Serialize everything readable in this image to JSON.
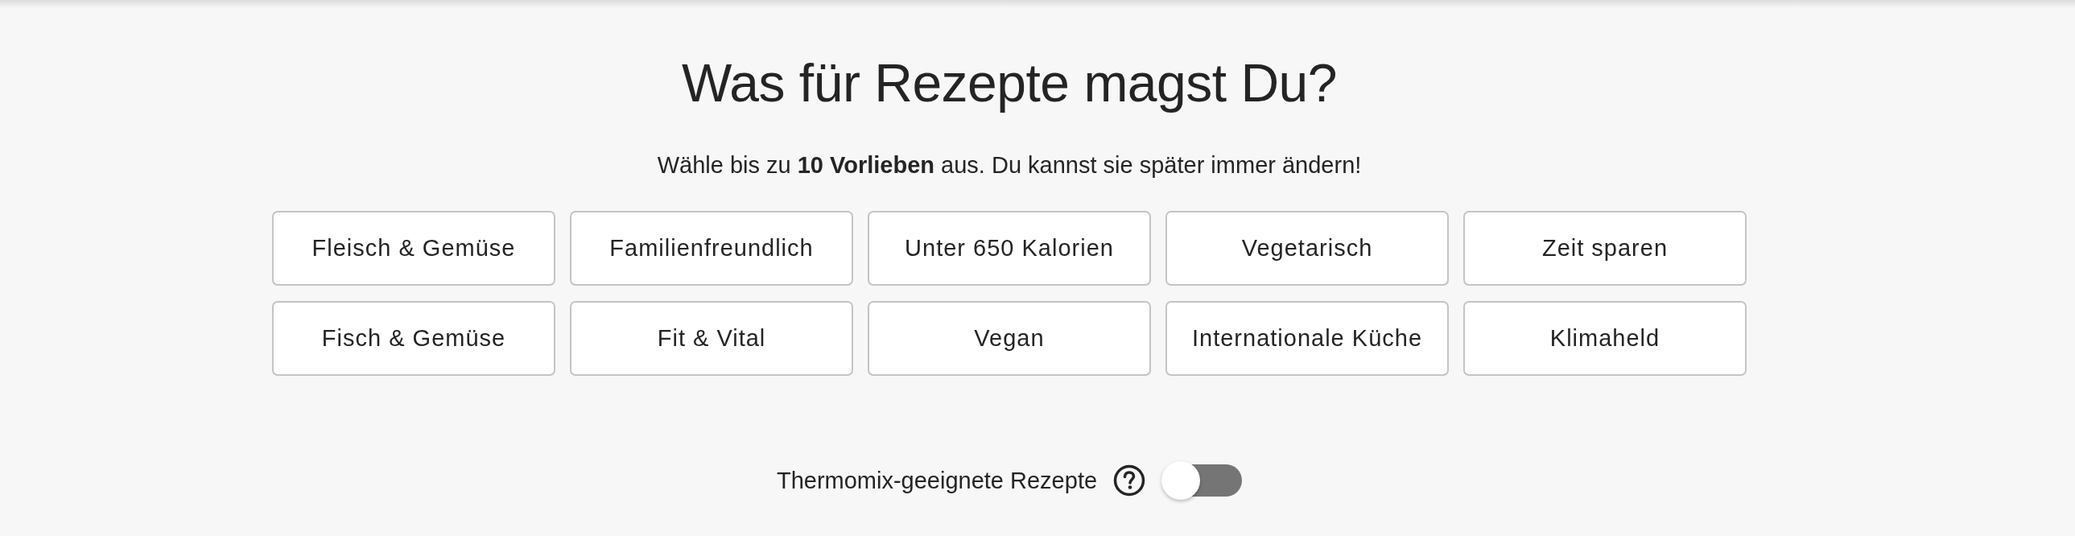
{
  "heading": "Was für Rezepte magst Du?",
  "subheading": "Wähle bis zu **10 Vorlieben** aus. Du kannst sie später immer ändern!",
  "preferences": [
    {
      "label": "Fleisch & Gemüse",
      "selected": false
    },
    {
      "label": "Familienfreundlich",
      "selected": false
    },
    {
      "label": "Unter 650 Kalorien",
      "selected": false
    },
    {
      "label": "Vegetarisch",
      "selected": false
    },
    {
      "label": "Zeit sparen",
      "selected": false
    },
    {
      "label": "Fisch & Gemüse",
      "selected": false
    },
    {
      "label": "Fit & Vital",
      "selected": false
    },
    {
      "label": "Vegan",
      "selected": false
    },
    {
      "label": "Internationale Küche",
      "selected": false
    },
    {
      "label": "Klimaheld",
      "selected": false
    }
  ],
  "thermomix_filter": {
    "label": "Thermomix-geeignete Rezepte",
    "on": false
  }
}
